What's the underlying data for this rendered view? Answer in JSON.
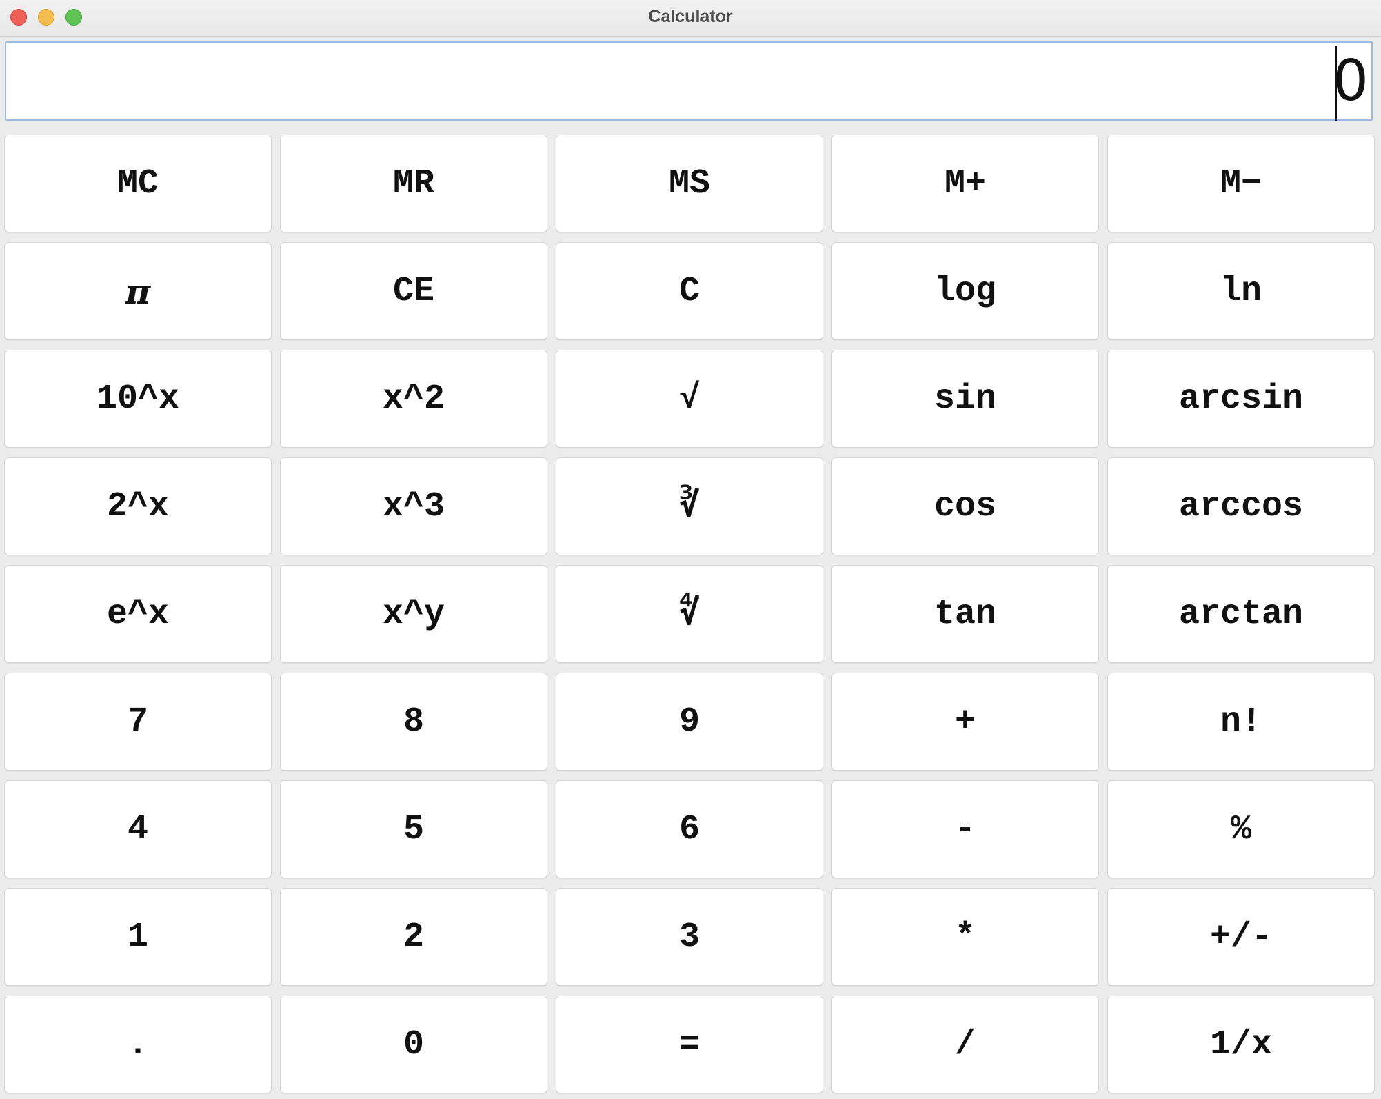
{
  "window": {
    "title": "Calculator"
  },
  "display": {
    "value": "0"
  },
  "keys": [
    "MC",
    "MR",
    "MS",
    "M+",
    "M−",
    "π",
    "CE",
    "C",
    "log",
    "ln",
    "10^x",
    "x^2",
    "√",
    "sin",
    "arcsin",
    "2^x",
    "x^3",
    "∛",
    "cos",
    "arccos",
    "e^x",
    "x^y",
    "∜",
    "tan",
    "arctan",
    "7",
    "8",
    "9",
    "+",
    "n!",
    "4",
    "5",
    "6",
    "-",
    "%",
    "1",
    "2",
    "3",
    "*",
    "+/-",
    ".",
    "0",
    "=",
    "/",
    "1/x"
  ]
}
